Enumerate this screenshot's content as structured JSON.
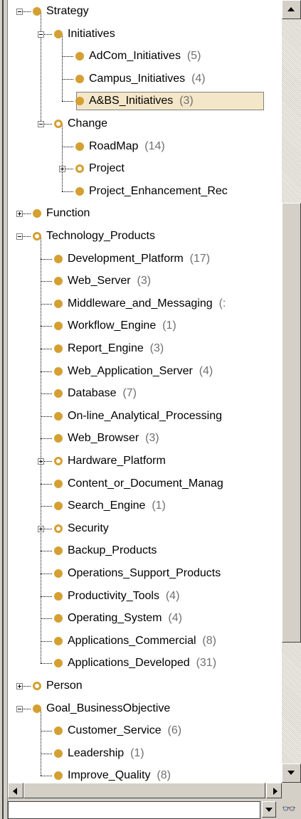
{
  "tree": {
    "nodes": [
      {
        "label": "Strategy",
        "count": "",
        "depth": 0,
        "expander": "minus",
        "ring": false
      },
      {
        "label": "Initiatives",
        "count": "",
        "depth": 1,
        "expander": "minus",
        "ring": false
      },
      {
        "label": "AdCom_Initiatives",
        "count": "(5)",
        "depth": 2,
        "expander": "",
        "ring": false
      },
      {
        "label": "Campus_Initiatives",
        "count": "(4)",
        "depth": 2,
        "expander": "",
        "ring": false
      },
      {
        "label": "A&BS_Initiatives",
        "count": "(3)",
        "depth": 2,
        "expander": "",
        "ring": false,
        "selected": true
      },
      {
        "label": "Change",
        "count": "",
        "depth": 1,
        "expander": "minus",
        "ring": true
      },
      {
        "label": "RoadMap",
        "count": "(14)",
        "depth": 2,
        "expander": "",
        "ring": false
      },
      {
        "label": "Project",
        "count": "",
        "depth": 2,
        "expander": "plus",
        "ring": true
      },
      {
        "label": "Project_Enhancement_Rec",
        "count": "",
        "depth": 2,
        "expander": "",
        "ring": false
      },
      {
        "label": "Function",
        "count": "",
        "depth": 0,
        "expander": "plus",
        "ring": false
      },
      {
        "label": "Technology_Products",
        "count": "",
        "depth": 0,
        "expander": "minus",
        "ring": true
      },
      {
        "label": "Development_Platform",
        "count": "(17)",
        "depth": 1,
        "expander": "",
        "ring": false
      },
      {
        "label": "Web_Server",
        "count": "(3)",
        "depth": 1,
        "expander": "",
        "ring": false
      },
      {
        "label": "Middleware_and_Messaging",
        "count": "(:",
        "depth": 1,
        "expander": "",
        "ring": false
      },
      {
        "label": "Workflow_Engine",
        "count": "(1)",
        "depth": 1,
        "expander": "",
        "ring": false
      },
      {
        "label": "Report_Engine",
        "count": "(3)",
        "depth": 1,
        "expander": "",
        "ring": false
      },
      {
        "label": "Web_Application_Server",
        "count": "(4)",
        "depth": 1,
        "expander": "",
        "ring": false
      },
      {
        "label": "Database",
        "count": "(7)",
        "depth": 1,
        "expander": "",
        "ring": false
      },
      {
        "label": "On-line_Analytical_Processing",
        "count": "",
        "depth": 1,
        "expander": "",
        "ring": false
      },
      {
        "label": "Web_Browser",
        "count": "(3)",
        "depth": 1,
        "expander": "",
        "ring": false
      },
      {
        "label": "Hardware_Platform",
        "count": "",
        "depth": 1,
        "expander": "plus",
        "ring": true
      },
      {
        "label": "Content_or_Document_Manag",
        "count": "",
        "depth": 1,
        "expander": "",
        "ring": false
      },
      {
        "label": "Search_Engine",
        "count": "(1)",
        "depth": 1,
        "expander": "",
        "ring": false
      },
      {
        "label": "Security",
        "count": "",
        "depth": 1,
        "expander": "plus",
        "ring": true
      },
      {
        "label": "Backup_Products",
        "count": "",
        "depth": 1,
        "expander": "",
        "ring": false
      },
      {
        "label": "Operations_Support_Products",
        "count": "",
        "depth": 1,
        "expander": "",
        "ring": false
      },
      {
        "label": "Productivity_Tools",
        "count": "(4)",
        "depth": 1,
        "expander": "",
        "ring": false
      },
      {
        "label": "Operating_System",
        "count": "(4)",
        "depth": 1,
        "expander": "",
        "ring": false
      },
      {
        "label": "Applications_Commercial",
        "count": "(8)",
        "depth": 1,
        "expander": "",
        "ring": false
      },
      {
        "label": "Applications_Developed",
        "count": "(31)",
        "depth": 1,
        "expander": "",
        "ring": false
      },
      {
        "label": "Person",
        "count": "",
        "depth": 0,
        "expander": "plus",
        "ring": true
      },
      {
        "label": "Goal_BusinessObjective",
        "count": "",
        "depth": 0,
        "expander": "minus",
        "ring": false
      },
      {
        "label": "Customer_Service",
        "count": "(6)",
        "depth": 1,
        "expander": "",
        "ring": false
      },
      {
        "label": "Leadership",
        "count": "(1)",
        "depth": 1,
        "expander": "",
        "ring": false
      },
      {
        "label": "Improve_Quality",
        "count": "(8)",
        "depth": 1,
        "expander": "",
        "ring": false
      }
    ]
  },
  "search": {
    "value": "",
    "find_icon_glyph": "🔍"
  },
  "colors": {
    "class_dot": "#d4a032",
    "selection_bg": "#f4e6c8"
  }
}
